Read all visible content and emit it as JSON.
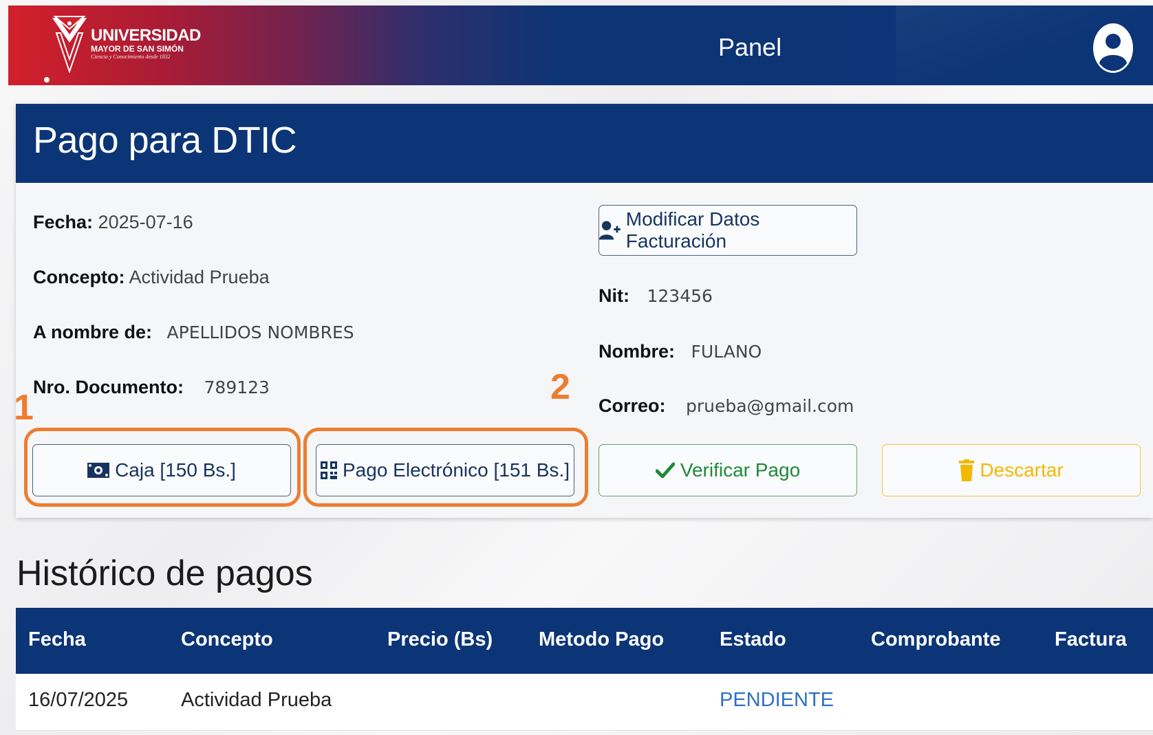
{
  "header": {
    "logo": {
      "main": "UNIVERSIDAD",
      "sub": "MAYOR DE SAN SIMÓN",
      "tagline": "Ciencia y Conocimiento desde 1832"
    },
    "title": "Panel"
  },
  "payment": {
    "title": "Pago para DTIC",
    "left_fields": {
      "fecha": {
        "label": "Fecha:",
        "value": "2025-07-16"
      },
      "concepto": {
        "label": "Concepto:",
        "value": "Actividad Prueba"
      },
      "a_nombre": {
        "label": "A nombre de:",
        "value": "APELLIDOS NOMBRES"
      },
      "nro_documento": {
        "label": "Nro. Documento:",
        "value": "789123"
      }
    },
    "right_fields": {
      "modificar_label": "Modificar Datos Facturación",
      "nit": {
        "label": "Nit:",
        "value": "123456"
      },
      "nombre": {
        "label": "Nombre:",
        "value": "FULANO"
      },
      "correo": {
        "label": "Correo:",
        "value": "prueba@gmail.com"
      }
    },
    "buttons": {
      "caja": "Caja [150 Bs.]",
      "electronico": "Pago Electrónico [151 Bs.]",
      "verificar": "Verificar Pago",
      "descartar": "Descartar"
    },
    "annotations": {
      "one": "1",
      "two": "2"
    },
    "colors": {
      "primary": "#0c3577",
      "annotation": "#ed7d31",
      "verify": "#1e8a3a",
      "discard": "#f3b800",
      "pending": "#2f6fc6"
    }
  },
  "history": {
    "title": "Histórico de pagos",
    "columns": [
      "Fecha",
      "Concepto",
      "Precio (Bs)",
      "Metodo Pago",
      "Estado",
      "Comprobante",
      "Factura"
    ],
    "rows": [
      {
        "fecha": "16/07/2025",
        "concepto": "Actividad Prueba",
        "precio": "",
        "metodo": "",
        "estado": "PENDIENTE",
        "comprobante": "",
        "factura": ""
      }
    ]
  },
  "icons": [
    "user-circle-icon",
    "user-plus-icon",
    "money-bill-icon",
    "qrcode-icon",
    "check-icon",
    "trash-icon"
  ]
}
